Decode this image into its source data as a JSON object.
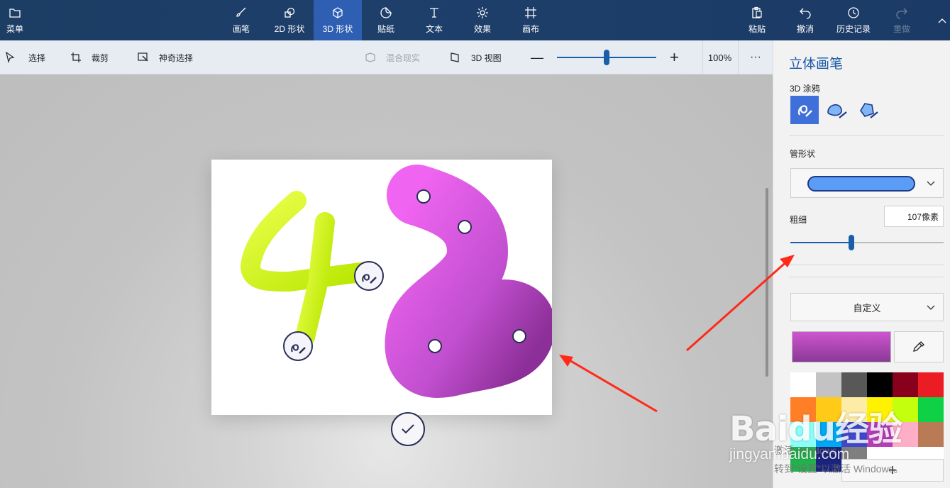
{
  "topbar": {
    "menu_label": "菜单",
    "tools": [
      {
        "label": "画笔",
        "icon": "brush-icon"
      },
      {
        "label": "2D 形状",
        "icon": "2d-shape-icon"
      },
      {
        "label": "3D 形状",
        "icon": "3d-shape-icon",
        "active": true
      },
      {
        "label": "贴纸",
        "icon": "sticker-icon"
      },
      {
        "label": "文本",
        "icon": "text-icon"
      },
      {
        "label": "效果",
        "icon": "effects-icon"
      },
      {
        "label": "画布",
        "icon": "canvas-icon"
      }
    ],
    "paste_label": "粘贴",
    "undo_label": "撤消",
    "history_label": "历史记录",
    "redo_label": "重做"
  },
  "toolbar": {
    "select_label": "选择",
    "crop_label": "裁剪",
    "magic_select_label": "神奇选择",
    "mixed_reality_label": "混合现实",
    "view3d_label": "3D 视图",
    "zoom_label": "100%",
    "zoom_level_fraction": 0.47,
    "more_label": "···"
  },
  "panel": {
    "title": "立体画笔",
    "doodle_label": "3D 涂鸦",
    "tube_label": "管形状",
    "thickness_label": "粗细",
    "thickness_value": "107像素",
    "thickness_fraction": 0.4,
    "color_mode_label": "自定义",
    "selected_color": "#b047b8",
    "palette": [
      "#ffffff",
      "#c3c3c3",
      "#585858",
      "#000000",
      "#88001b",
      "#ec1c24",
      "#ff7f27",
      "#ffca18",
      "#fdeca6",
      "#fff200",
      "#c4ff0e",
      "#0ed145",
      "#8cfffb",
      "#00a8f3",
      "#3f48cc",
      "#b83dba",
      "#ffaec8",
      "#b97a56",
      "#22b14c",
      "#1a237e",
      "#7f7f7f",
      "#ffffff",
      "#ffffff",
      "#ffffff"
    ],
    "add_color_label": "+"
  },
  "colors": {
    "accent": "#1b5aa8",
    "topbar_bg": "#1c3d64",
    "active_tab": "#2f5fb3",
    "yellow_stroke": "#d9ff1a",
    "purple_stroke": "#c74fd0"
  },
  "watermark": {
    "logo": "Baidu经验",
    "url": "jingyan.baidu.com",
    "activate_line1": "激活 Windows",
    "activate_line2": "转到\"设置\"以激活 Windows。"
  }
}
